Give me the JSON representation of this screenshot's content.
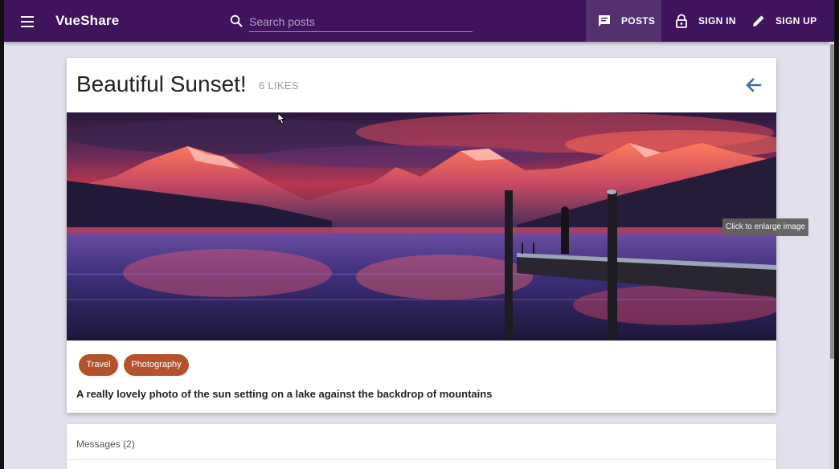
{
  "appbar": {
    "brand": "VueShare",
    "search_placeholder": "Search posts",
    "nav": {
      "posts": "POSTS",
      "sign_in": "SIGN IN",
      "sign_up": "SIGN UP"
    },
    "bg_color": "#40135d"
  },
  "post": {
    "title": "Beautiful Sunset!",
    "likes": "6 LIKES",
    "image_tooltip": "Click to enlarge image",
    "categories": [
      "Travel",
      "Photography"
    ],
    "description": "A really lovely photo of the sun setting on a lake against the backdrop of mountains"
  },
  "messages": {
    "title": "Messages (2)"
  },
  "icons": {
    "menu": "menu-icon",
    "search": "search-icon",
    "posts": "chat-icon",
    "sign_in": "lock-icon",
    "sign_up": "pencil-icon",
    "back": "arrow-back-icon"
  },
  "colors": {
    "accent": "#b5522e",
    "back_arrow": "#3f6ea8"
  }
}
